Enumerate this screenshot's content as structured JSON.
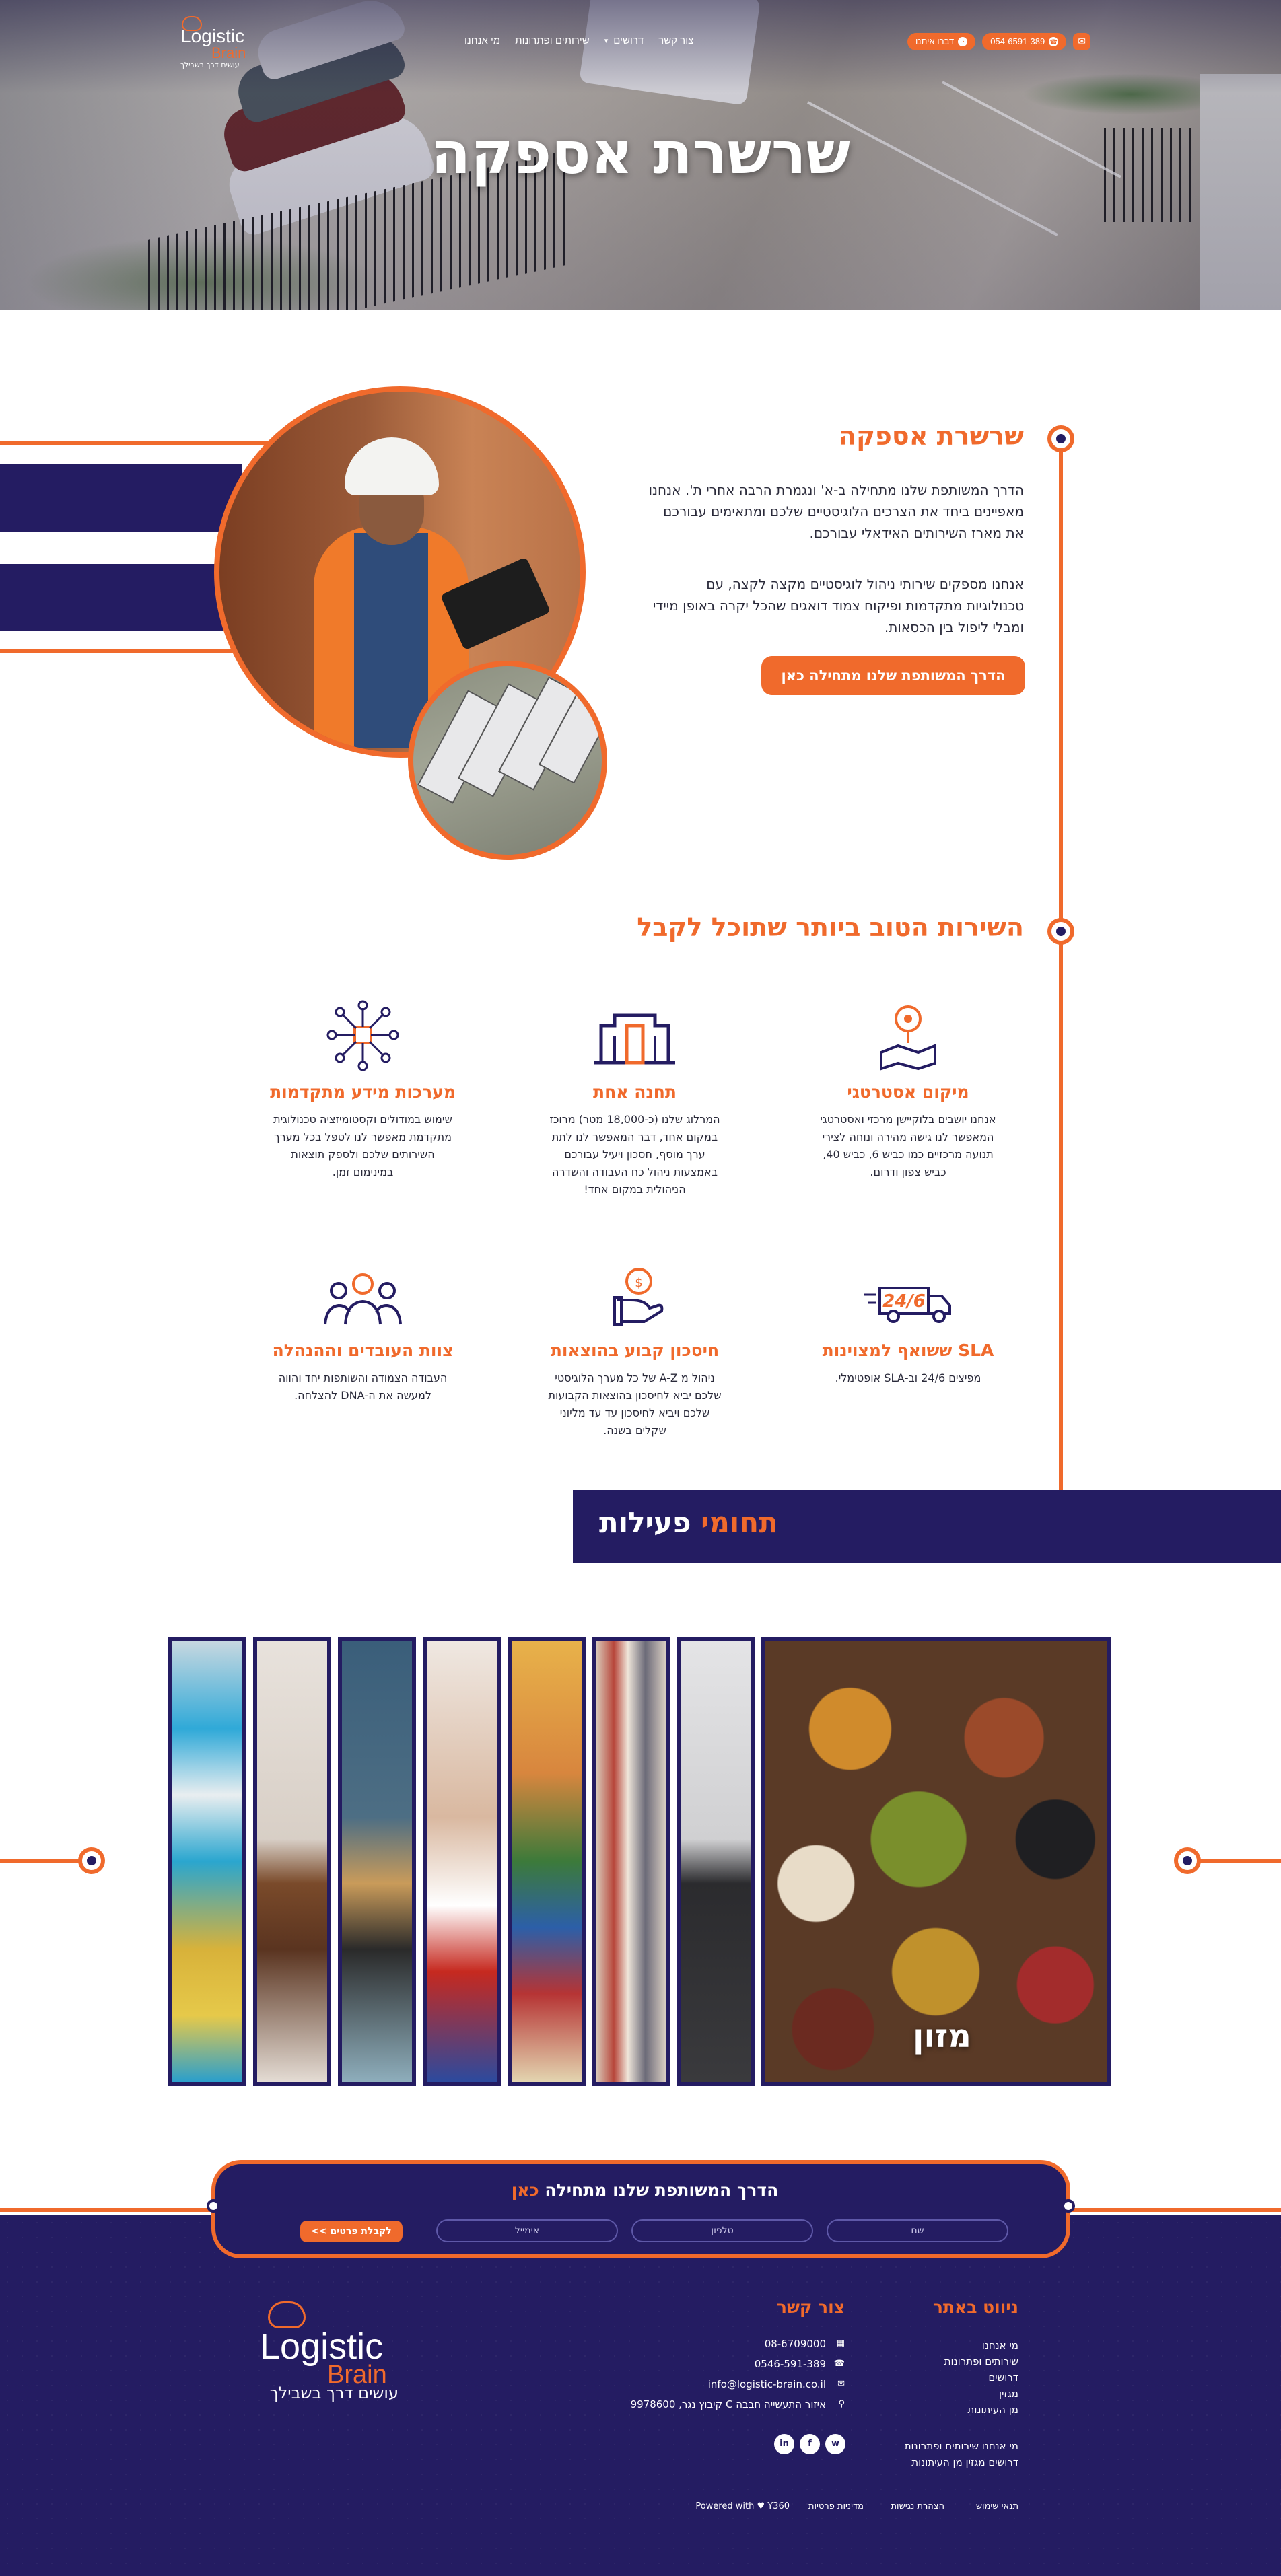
{
  "header": {
    "logo": {
      "word1": "Logistic",
      "word2": "Brain",
      "tagline": "עושים דרך בשבילך"
    },
    "nav": [
      {
        "label": "מי אנחנו"
      },
      {
        "label": "שירותים ופתרונות"
      },
      {
        "label": "דרושים"
      },
      {
        "label": "צור קשר"
      }
    ],
    "phone": "054-6591-389",
    "whatsapp": "דברו איתנו"
  },
  "hero": {
    "title": "שרשרת אספקה"
  },
  "about": {
    "title": "שרשרת אספקה",
    "paragraph1": "הדרך המשותפת שלנו מתחילה ב-א' ונגמרת הרבה אחרי ת'. אנחנו מאפיינים ביחד את הצרכים הלוגיסטיים שלכם ומתאימים עבורכם את מארז השירותים האידאלי עבורכם.",
    "paragraph2": "אנחנו מספקים שירותי ניהול לוגיסטיים מקצה לקצה, עם טכנולוגיות מתקדמות ופיקוח צמוד דואגים שהכל יקרה באופן מיידי ומבלי ליפול בין הכסאות.",
    "cta": "הדרך המשותפת שלנו מתחילה כאן"
  },
  "services": {
    "title": "השירות הטוב ביותר שתוכל לקבל",
    "items": [
      {
        "icon": "location-map-icon",
        "title": "מיקום אסטרטגי",
        "text": "אנחנו יושבים בלוקיישן מרכזי ואסטרטגי המאפשר לנו גישה מהירה ונוחה לצירי תנועה מרכזיים כמו כביש 6, כביש 40, כביש צפון ודרום."
      },
      {
        "icon": "warehouse-icon",
        "title": "תחנה אחת",
        "text": "המרלוג שלנו (כ-18,000 מטר) מרוכז במקום אחד, דבר המאפשר לנו לתת ערך מוסף, חסכון ויעיל עבורכם באמצעות ניהול כח העבודה והשדרה הניהולית במקום אחד!"
      },
      {
        "icon": "network-box-icon",
        "title": "מערכות מידע מתקדמות",
        "text": "שימוש במודולים וקסטומיזציה טכנולוגית מתקדמת מאפשר לנו לטפל בכל מערך השירותים שלכם ולספק תוצאות במינימום זמן."
      },
      {
        "icon": "delivery-truck-24-6-icon",
        "title": "SLA ששואף למצוינות",
        "text": "מפיצים 24/6 וב-SLA אופטימלי."
      },
      {
        "icon": "hand-coin-icon",
        "title": "חיסכון קבוע בהוצאות",
        "text": "ניהול מ A-Z של כל מערך הלוגיסטי שלכם יביא לחיסכון בהוצאות הקבועות שלכם ויביא לחיסכון עד עד מליוני שקלים בשנה."
      },
      {
        "icon": "team-people-icon",
        "title": "צוות העובדים וההנהלה",
        "text": "העבודה הצמודה והשותפות יחד והווה למעשה את ה-DNA להצלחה."
      }
    ],
    "truck_badge": "24/6"
  },
  "fields": {
    "title_word1": "תחומי",
    "title_word2": "פעילות",
    "gallery_label": "מזון"
  },
  "cta_form": {
    "title": "הדרך המשותפת שלנו מתחילה",
    "title_highlight": "כאן",
    "name_placeholder": "שם",
    "phone_placeholder": "טלפון",
    "email_placeholder": "אימייל",
    "submit": "לקבלת פרטים >>"
  },
  "footer": {
    "nav_title": "ניווט באתר",
    "nav_links": [
      "מי אנחנו",
      "שירותים ופתרונות",
      "דרושים",
      "מגזין",
      "מן העיתונות"
    ],
    "nav_links_inline_1": "מי אנחנו   שירותים ופתרונות",
    "nav_links_inline_2": "דרושים   מגזין   מן העיתונות",
    "contact_title": "צור קשר",
    "fax": "08-6709000",
    "phone": "0546-591-389",
    "email": "info@logistic-brain.co.il",
    "address": "איזור התעשייה חבבה C קיבוץ נגר, 9978600",
    "bottom_links": [
      "תנאי שימוש",
      "הצהרת נגישות",
      "מדיניות פרטיות"
    ],
    "powered": "Powered with ♥ Y360",
    "social": [
      "in",
      "f",
      "w"
    ]
  },
  "colors": {
    "accent": "#f06a2c",
    "navy": "#241c62"
  }
}
